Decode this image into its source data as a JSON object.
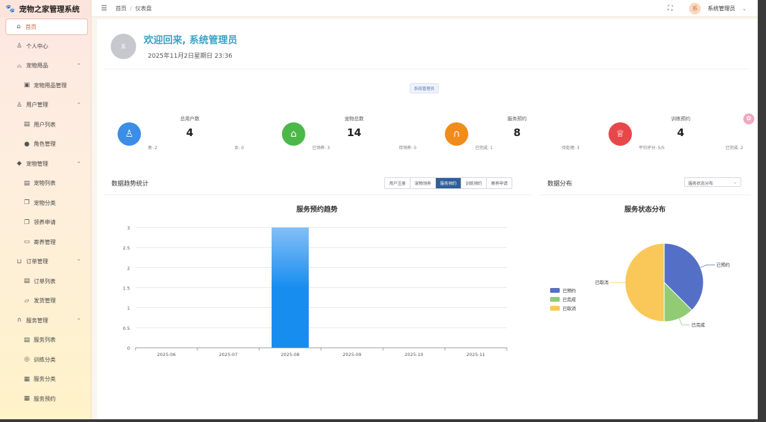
{
  "app": {
    "title": "宠物之家管理系统",
    "logo_icon": "paw-icon"
  },
  "sidebar": {
    "items": [
      {
        "label": "首页",
        "icon": "home-icon",
        "level": 0,
        "active": true
      },
      {
        "label": "个人中心",
        "icon": "user-icon",
        "level": 0
      },
      {
        "label": "宠物用品",
        "icon": "bag-icon",
        "level": 0,
        "expandable": true
      },
      {
        "label": "宠物用品管理",
        "icon": "shop-icon",
        "level": 1
      },
      {
        "label": "用户管理",
        "icon": "user-icon",
        "level": 0,
        "expandable": true
      },
      {
        "label": "用户列表",
        "icon": "list-icon",
        "level": 1
      },
      {
        "label": "角色管理",
        "icon": "person-icon",
        "level": 1
      },
      {
        "label": "宠物管理",
        "icon": "pet-icon",
        "level": 0,
        "expandable": true
      },
      {
        "label": "宠物列表",
        "icon": "list-icon",
        "level": 1
      },
      {
        "label": "宠物分类",
        "icon": "copy-icon",
        "level": 1
      },
      {
        "label": "领养申请",
        "icon": "copy-icon",
        "level": 1
      },
      {
        "label": "寄养管理",
        "icon": "cup-icon",
        "level": 1
      },
      {
        "label": "订单管理",
        "icon": "cart-icon",
        "level": 0,
        "expandable": true
      },
      {
        "label": "订单列表",
        "icon": "list-icon",
        "level": 1
      },
      {
        "label": "发货管理",
        "icon": "truck-icon",
        "level": 1
      },
      {
        "label": "服务管理",
        "icon": "headset-icon",
        "level": 0,
        "expandable": true
      },
      {
        "label": "服务列表",
        "icon": "list-icon",
        "level": 1
      },
      {
        "label": "训练分类",
        "icon": "target-icon",
        "level": 1
      },
      {
        "label": "服务分类",
        "icon": "box-icon",
        "level": 1
      },
      {
        "label": "服务预约",
        "icon": "calendar-icon",
        "level": 1
      }
    ]
  },
  "topbar": {
    "breadcrumb": [
      "首页",
      "仪表盘"
    ],
    "user_initial": "系",
    "user_name": "系统管理员"
  },
  "welcome": {
    "avatar_text": "系",
    "greeting": "欢迎回来, 系统管理员",
    "datetime": "2025年11月2日星期日 23:36",
    "role_tag": "系统管理员"
  },
  "stats": [
    {
      "label": "总用户数",
      "value": "4",
      "sub1": "男: 2",
      "sub2": "女: 0",
      "color": "#3a8ee6",
      "icon": "user-icon"
    },
    {
      "label": "宠物总数",
      "value": "14",
      "sub1": "已领养: 3",
      "sub2": "待领养: 0",
      "color": "#4cb84a",
      "icon": "home-icon"
    },
    {
      "label": "服务预约",
      "value": "8",
      "sub1": "已完成: 1",
      "sub2": "待处理: 3",
      "color": "#f08c1b",
      "icon": "headset-icon"
    },
    {
      "label": "训练预约",
      "value": "4",
      "sub1": "平均评分: 5/5",
      "sub2": "已完成: 2",
      "color": "#e8474a",
      "icon": "trophy-icon"
    }
  ],
  "trend": {
    "title": "数据趋势统计",
    "tabs": [
      "用户注册",
      "宠物领养",
      "服务预约",
      "训练预约",
      "寄养申请"
    ],
    "active_tab": 2
  },
  "distribution": {
    "title": "数据分布",
    "select_value": "服务状态分布"
  },
  "chart_data": [
    {
      "type": "bar",
      "title": "服务预约趋势",
      "categories": [
        "2025-06",
        "2025-07",
        "2025-08",
        "2025-09",
        "2025-10",
        "2025-11"
      ],
      "values": [
        0,
        0,
        3,
        0,
        0,
        0
      ],
      "ylim": [
        0,
        3
      ],
      "yticks": [
        "0",
        "0.5",
        "1",
        "1.5",
        "2",
        "2.5",
        "3"
      ],
      "color": "#1e8ef0"
    },
    {
      "type": "pie",
      "title": "服务状态分布",
      "labels": [
        "已预约",
        "已完成",
        "已取消"
      ],
      "values": [
        3,
        1,
        4
      ],
      "colors": [
        "#5470c6",
        "#91cc75",
        "#fac858"
      ],
      "legend": "left"
    }
  ]
}
